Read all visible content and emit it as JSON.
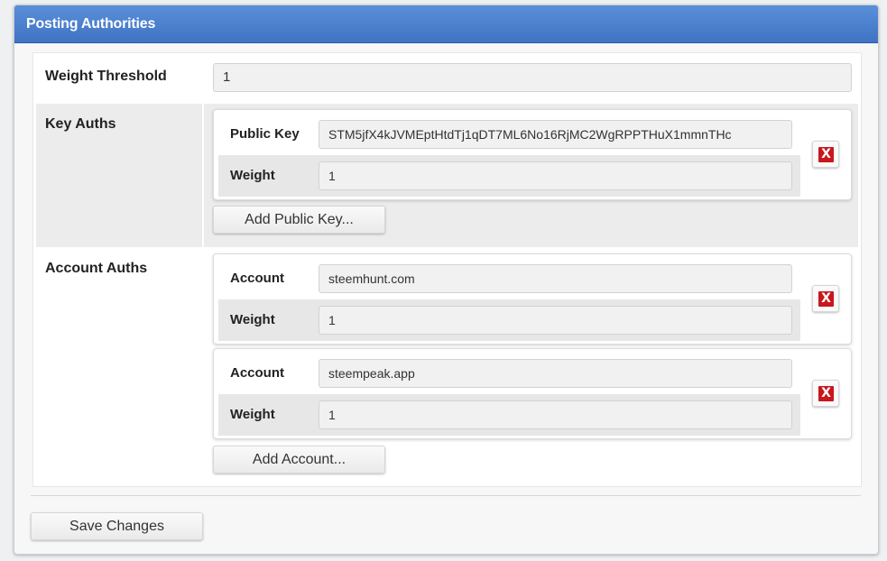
{
  "panel": {
    "title": "Posting Authorities"
  },
  "weight_threshold": {
    "label": "Weight Threshold",
    "value": "1"
  },
  "key_auths": {
    "label": "Key Auths",
    "entries": [
      {
        "key_label": "Public Key",
        "key_value": "STM5jfX4kJVMEptHtdTj1qDT7ML6No16RjMC2WgRPPTHuX1mmnTHc",
        "weight_label": "Weight",
        "weight_value": "1"
      }
    ],
    "add_button": "Add Public Key..."
  },
  "account_auths": {
    "label": "Account Auths",
    "entries": [
      {
        "account_label": "Account",
        "account_value": "steemhunt.com",
        "weight_label": "Weight",
        "weight_value": "1"
      },
      {
        "account_label": "Account",
        "account_value": "steempeak.app",
        "weight_label": "Weight",
        "weight_value": "1"
      }
    ],
    "add_button": "Add Account..."
  },
  "remove_icon_glyph": "X",
  "save_button": "Save Changes",
  "colors": {
    "header": "#4a80cf",
    "remove": "#c8171d"
  }
}
